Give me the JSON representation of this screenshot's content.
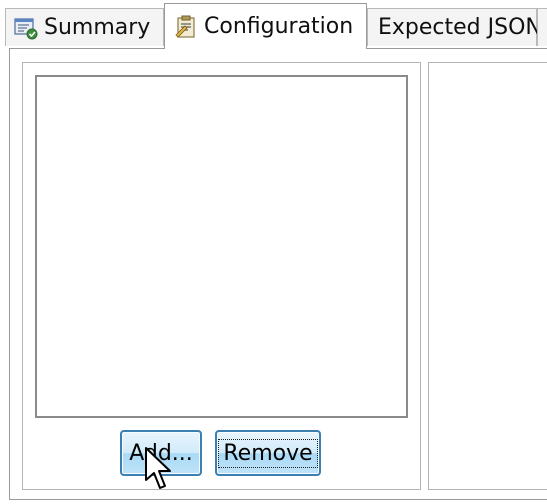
{
  "tabs": [
    {
      "label": "Summary",
      "icon": "summary-report-icon",
      "active": false
    },
    {
      "label": "Configuration",
      "icon": "configuration-clipboard-icon",
      "active": true
    },
    {
      "label": "Expected JSON",
      "active": false
    }
  ],
  "configuration": {
    "list_items": [],
    "add_button_label": "Add...",
    "remove_button_label": "Remove"
  },
  "colors": {
    "button_border": "#3c7fb1",
    "button_fill": "#bfe3f8",
    "tab_border": "#9a9a9a"
  }
}
